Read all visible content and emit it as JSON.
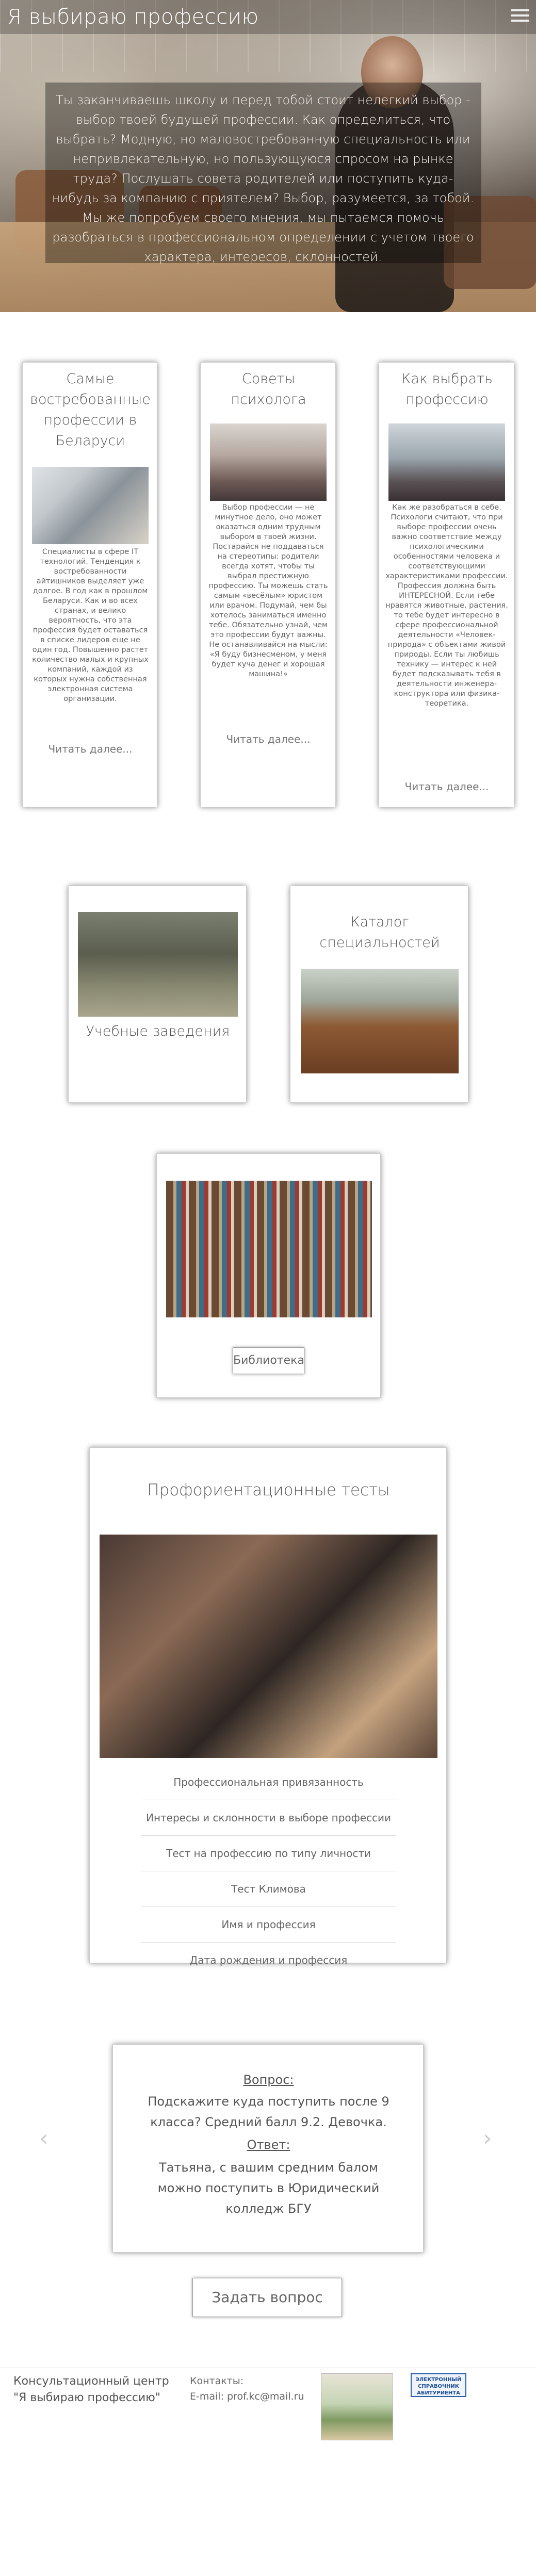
{
  "header": {
    "site_title": "Я выбираю профессию"
  },
  "hero": {
    "text": "Ты заканчиваешь школу и перед тобой стоит нелегкий выбор - выбор твоей будущей профессии. Как определиться, что выбрать? Модную, но маловостребованную специальность или непривлекательную, но пользующуюся спросом на рынке труда? Послушать совета родителей или поступить куда-нибудь за компанию с приятелем? Выбор, разумеется, за тобой. Мы же попробуем своего мнения, мы пытаемся помочь разобраться в профессиональном определении с учетом твоего характера, интересов, склонностей."
  },
  "cards_row1": [
    {
      "title": "Самые востребованные профессии в Беларуси",
      "text": "Специалисты в сфере IT технологий. Тенденция к востребованности айтишников выделяет уже долгое. В год как в прошлом Беларуси. Как и во всех странах, и велико вероятность, что эта профессия будет оставаться в списке лидеров еще не один год. Повышенно растет количество малых и крупных компаний, каждой из которых нужна собственная электронная система организации.",
      "more": "Читать далее..."
    },
    {
      "title": "Советы психолога",
      "text": "Выбор профессии — не минутное дело, оно может оказаться одним трудным выбором в твоей жизни. Постарайся не поддаваться на стереотипы: родители всегда хотят, чтобы ты выбрал престижную профессию. Ты можешь стать самым «весёлым» юристом или врачом. Подумай, чем бы хотелось заниматься именно тебе. Обязательно узнай, чем это профессии будут важны. Не останавливайся на мысли: «Я буду бизнесменом, у меня будет куча денег и хорошая машина!»",
      "more": "Читать далее..."
    },
    {
      "title": "Как выбрать профессию",
      "text": "Как же разобраться в себе. Психологи считают, что при выборе профессии очень важно соответствие между психологическими особенностями человека и соответствующими характеристиками профессии. Профессия должна быть ИНТЕРЕСНОЙ. Если тебе нравятся животные, растения, то тебе будет интересно в сфере профессиональной деятельности «Человек-природа» с объектами живой природы. Если ты любишь технику — интерес к ней будет подсказывать тебя в деятельности инженера-конструктора или физика-теоретика.",
      "more": "Читать далее..."
    }
  ],
  "cards_row2": [
    {
      "title": "Учебные заведения"
    },
    {
      "title": "Каталог специальностей"
    }
  ],
  "library": {
    "button": "Библиотека"
  },
  "tests": {
    "title": "Профориентационные тесты",
    "items": [
      "Профессиональная привязанность",
      "Интересы и склонности в выборе профессии",
      "Тест на профессию по типу личности",
      "Тест Климова",
      "Имя и профессия",
      "Дата рождения и профессия"
    ]
  },
  "qa": {
    "question_label": "Вопрос:",
    "question": "Подскажите куда поступить после 9 классa? Средний балл 9.2. Девочка.",
    "answer_label": "Ответ:",
    "answer": "Татьяна, с вашим средним балом можно поступить в Юридический колледж БГУ",
    "prev": "‹",
    "next": "›"
  },
  "ask_button": "Задать вопрос",
  "footer": {
    "org": "Консультационный центр \"Я выбираю профессию\"",
    "contacts_label": "Контакты:",
    "email": "E-mail: prof.kc@mail.ru",
    "badge_text": "ЭЛЕКТРОННЫЙ СПРАВОЧНИК АБИТУРИЕНТА"
  }
}
